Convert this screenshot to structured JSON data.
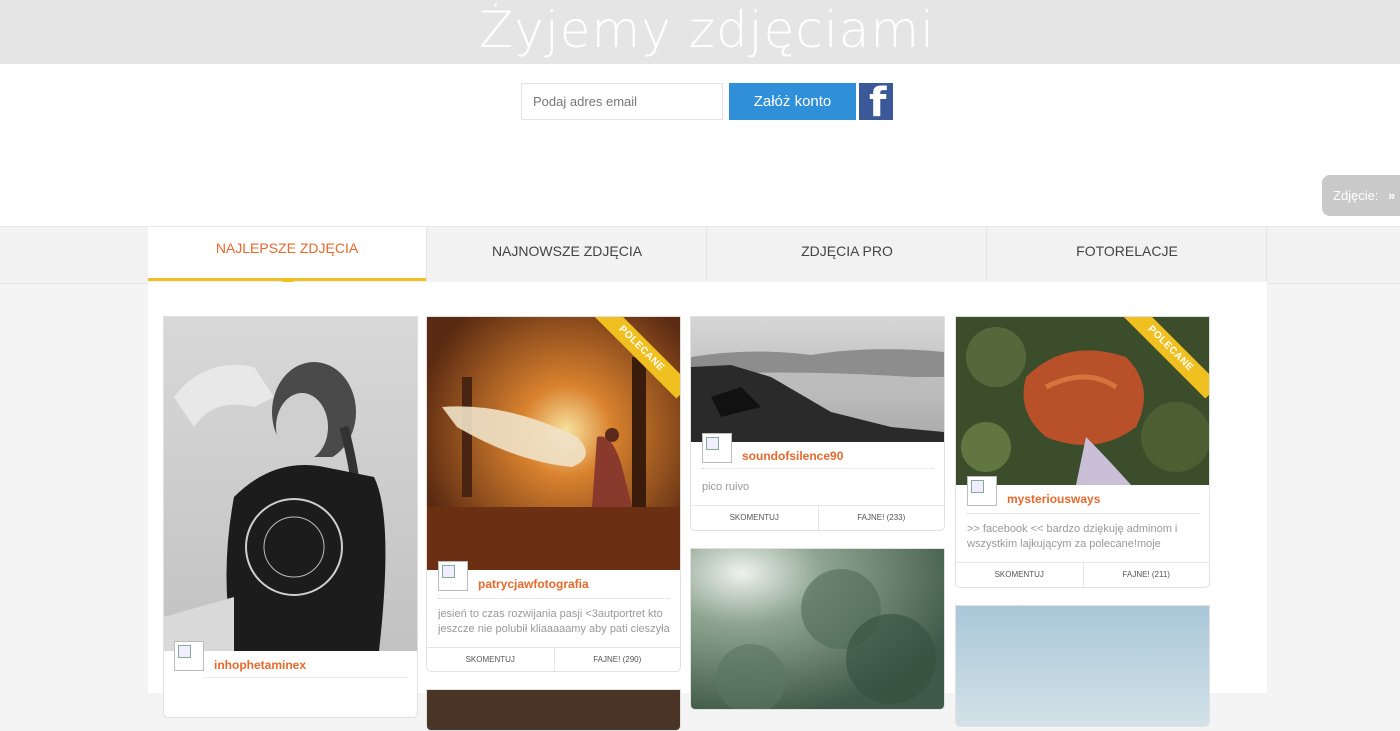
{
  "header": {
    "title": "Żyjemy zdjęciami"
  },
  "signup": {
    "email_placeholder": "Podaj adres email",
    "button_label": "Załóż konto",
    "facebook_glyph": "f"
  },
  "side_tab": {
    "label": "Zdjęcie:",
    "arrow": "»"
  },
  "tabs": [
    {
      "label": "NAJLEPSZE ZDJĘCIA",
      "active": true
    },
    {
      "label": "NAJNOWSZE ZDJĘCIA",
      "active": false
    },
    {
      "label": "ZDJĘCIA PRO",
      "active": false
    },
    {
      "label": "FOTORELACJE",
      "active": false
    }
  ],
  "photos": [
    {
      "user": "inhophetaminex",
      "desc": "",
      "featured": false
    },
    {
      "user": "patrycjawfotografia",
      "desc": "jesień to czas rozwijania pasji <3autportret kto jeszcze nie polubił kliaaaaamy aby pati cieszyła",
      "comment_label": "SKOMENTUJ",
      "like_label": "FAJNE! (290)",
      "featured": true,
      "ribbon": "POLECANE"
    },
    {
      "user": "soundofsilence90",
      "desc": "pico ruivo",
      "comment_label": "SKOMENTUJ",
      "like_label": "FAJNE! (233)",
      "featured": false
    },
    {
      "user": "mysteriousways",
      "desc": ">> facebook << bardzo dziękuję adminom i wszystkim lajkującym za polecane!moje pierwsze",
      "comment_label": "SKOMENTUJ",
      "like_label": "FAJNE! (211)",
      "featured": true,
      "ribbon": "POLECANE"
    }
  ],
  "colors": {
    "accent": "#e8692c",
    "tab_indicator": "#f0c020",
    "signup_button": "#2f8fd8",
    "facebook": "#3b5998"
  }
}
